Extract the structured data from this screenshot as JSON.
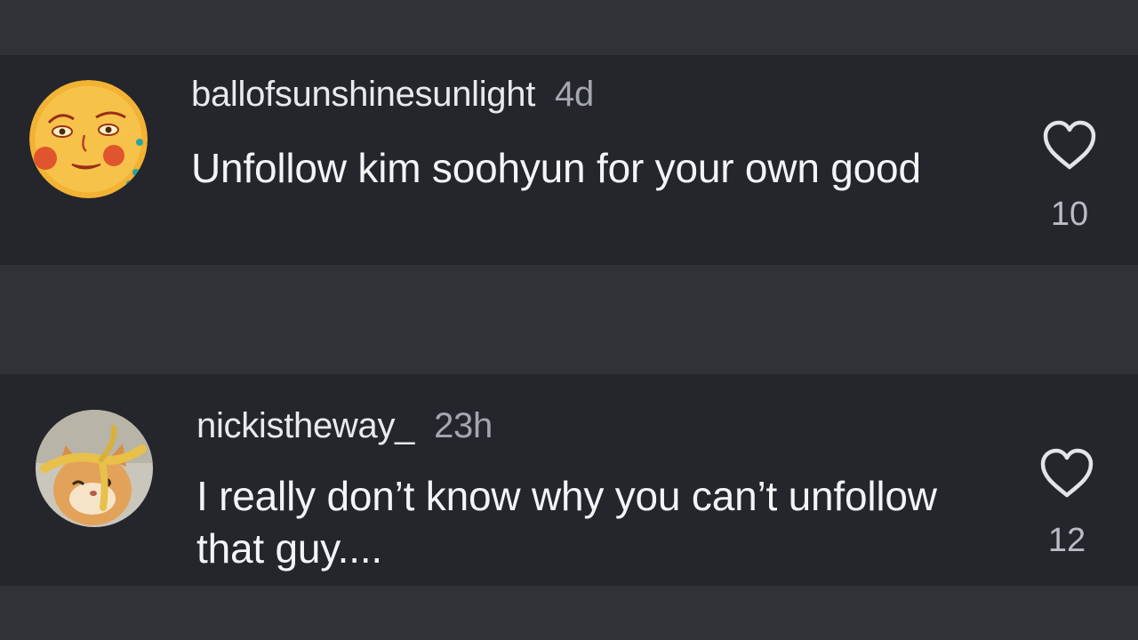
{
  "comments": [
    {
      "username": "ballofsunshinesunlight",
      "time": "4d",
      "text": "Unfollow kim soohyun for your own good",
      "likes": "10",
      "avatar_icon": "sun-face-illustration",
      "liked": false
    },
    {
      "username": "nickistheway_",
      "time": "23h",
      "text": "I really don’t know why you can’t unfollow that guy....",
      "likes": "12",
      "avatar_icon": "cat-with-banana-peel-photo",
      "liked": false
    }
  ],
  "colors": {
    "background": "#303237",
    "card": "#25262b",
    "text": "#f3f4f6",
    "secondary": "#a3a7b0"
  }
}
